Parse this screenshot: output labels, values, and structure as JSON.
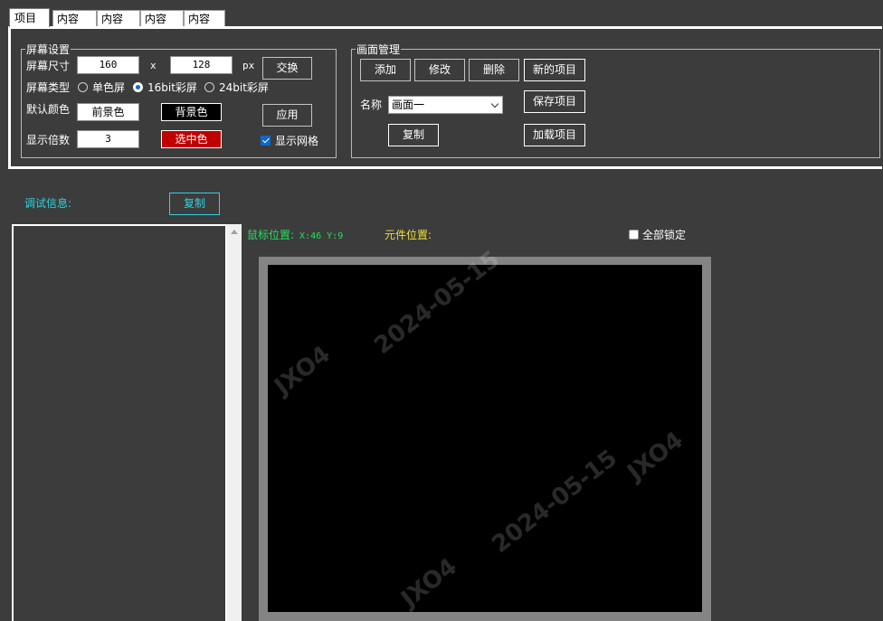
{
  "tabs": [
    "项目",
    "内容",
    "内容",
    "内容",
    "内容"
  ],
  "screen_settings": {
    "legend": "屏幕设置",
    "size_label": "屏幕尺寸",
    "width_value": "160",
    "times_label": "x",
    "height_value": "128",
    "unit_label": "px",
    "swap_button": "交换",
    "type_label": "屏幕类型",
    "type_options": [
      "单色屏",
      "16bit彩屏",
      "24bit彩屏"
    ],
    "type_selected": 1,
    "default_color_label": "默认颜色",
    "foreground_button": "前景色",
    "background_button": "背景色",
    "apply_button": "应用",
    "scale_label": "显示倍数",
    "scale_value": "3",
    "selected_color_button": "选中色",
    "show_grid_label": "显示网格",
    "show_grid_checked": true
  },
  "screen_manage": {
    "legend": "画面管理",
    "add_button": "添加",
    "edit_button": "修改",
    "delete_button": "删除",
    "new_project_button": "新的项目",
    "name_label": "名称",
    "name_selected": "画面一",
    "save_project_button": "保存项目",
    "copy_button": "复制",
    "load_project_button": "加载项目"
  },
  "debug": {
    "label": "调试信息:",
    "copy_button": "复制"
  },
  "status": {
    "mouse_label": "鼠标位置:",
    "mouse_value": "X:46 Y:9",
    "element_label": "元件位置:",
    "lock_all_label": "全部锁定",
    "lock_all_checked": false
  },
  "watermark": [
    "2024-05-15",
    "JXO4"
  ],
  "colors": {
    "background": "#3c3c3c",
    "foreground_swatch": "#ffffff",
    "background_swatch": "#000000",
    "selected_swatch": "#c00000",
    "debug_cyan": "#2ed3e0",
    "mouse_green": "#22e05a",
    "element_yellow": "#f0e030"
  }
}
